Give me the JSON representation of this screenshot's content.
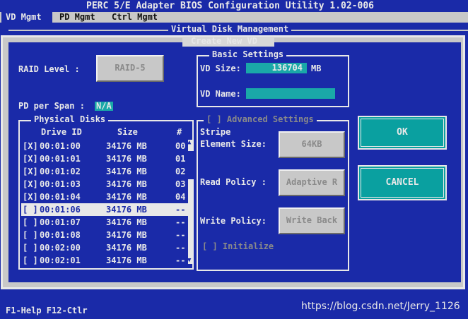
{
  "window": {
    "title": "PERC 5/E Adapter BIOS Configuration Utility 1.02-006"
  },
  "tabs": [
    {
      "label": "VD Mgmt"
    },
    {
      "label": "PD Mgmt"
    },
    {
      "label": "Ctrl Mgmt"
    }
  ],
  "panel": {
    "title": "Virtual Disk Management"
  },
  "dialog": {
    "title": "Create New VD",
    "raid_level_label": "RAID Level :",
    "raid_level_value": "RAID-5",
    "pd_per_span_label": "PD per Span :",
    "pd_per_span_value": "N/A",
    "physical_disks": {
      "title": "Physical Disks",
      "columns": [
        "Drive ID",
        "Size",
        "#"
      ],
      "rows": [
        {
          "check": "[X]",
          "id": "00:01:00",
          "size": "34176 MB",
          "num": "00"
        },
        {
          "check": "[X]",
          "id": "00:01:01",
          "size": "34176 MB",
          "num": "01"
        },
        {
          "check": "[X]",
          "id": "00:01:02",
          "size": "34176 MB",
          "num": "02"
        },
        {
          "check": "[X]",
          "id": "00:01:03",
          "size": "34176 MB",
          "num": "03"
        },
        {
          "check": "[X]",
          "id": "00:01:04",
          "size": "34176 MB",
          "num": "04"
        },
        {
          "check": "[ ]",
          "id": "00:01:06",
          "size": "34176 MB",
          "num": "--"
        },
        {
          "check": "[ ]",
          "id": "00:01:07",
          "size": "34176 MB",
          "num": "--"
        },
        {
          "check": "[ ]",
          "id": "00:01:08",
          "size": "34176 MB",
          "num": "--"
        },
        {
          "check": "[ ]",
          "id": "00:02:00",
          "size": "34176 MB",
          "num": "--"
        },
        {
          "check": "[ ]",
          "id": "00:02:01",
          "size": "34176 MB",
          "num": "--"
        }
      ]
    },
    "basic": {
      "title": "Basic Settings",
      "vd_size_label": "VD Size:",
      "vd_size_value": "136704",
      "vd_size_unit": "MB",
      "vd_name_label": "VD Name:",
      "vd_name_value": ""
    },
    "advanced": {
      "title": "[ ] Advanced Settings",
      "stripe_label_1": "Stripe",
      "stripe_label_2": "Element Size:",
      "stripe_value": "64KB",
      "read_label": "Read Policy :",
      "read_value": "Adaptive R",
      "write_label": "Write Policy:",
      "write_value": "Write Back",
      "initialize": "[ ] Initialize"
    },
    "ok_label": "OK",
    "cancel_label": "CANCEL"
  },
  "footer": {
    "help": "F1-Help F12-Ctlr"
  },
  "watermark": "https://blog.csdn.net/Jerry_1126"
}
